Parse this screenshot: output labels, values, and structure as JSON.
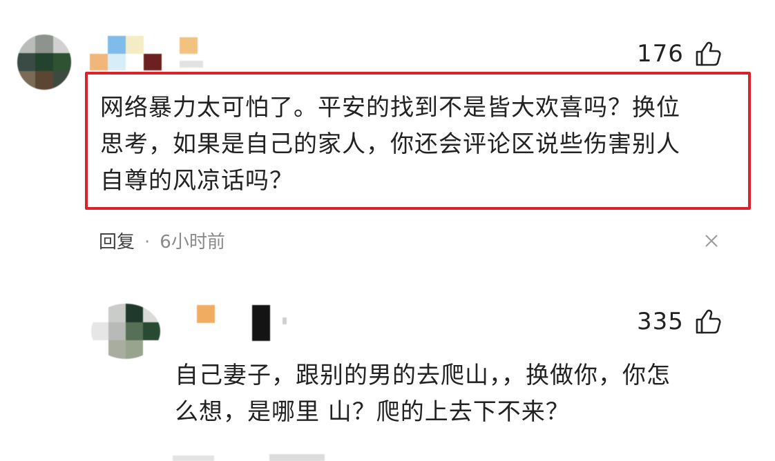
{
  "comments": [
    {
      "like_count": "176",
      "text_line1": "网络暴力太可怕了。平安的找到不是皆大欢喜吗？换位",
      "text_line2": "思考，如果是自己的家人，你还会评论区说些伤害别人",
      "text_line3": "自尊的风凉话吗？",
      "reply_label": "回复",
      "dot": "·",
      "time": "6小时前",
      "highlight_color": "#d9222a"
    },
    {
      "like_count": "335",
      "text_line1": "自己妻子，跟别的男的去爬山，，换做你，你怎",
      "text_line2": "么想，是哪里 山？爬的上去下不来？"
    }
  ],
  "icons": {
    "like": "thumbs-up-icon",
    "close": "close-icon"
  }
}
